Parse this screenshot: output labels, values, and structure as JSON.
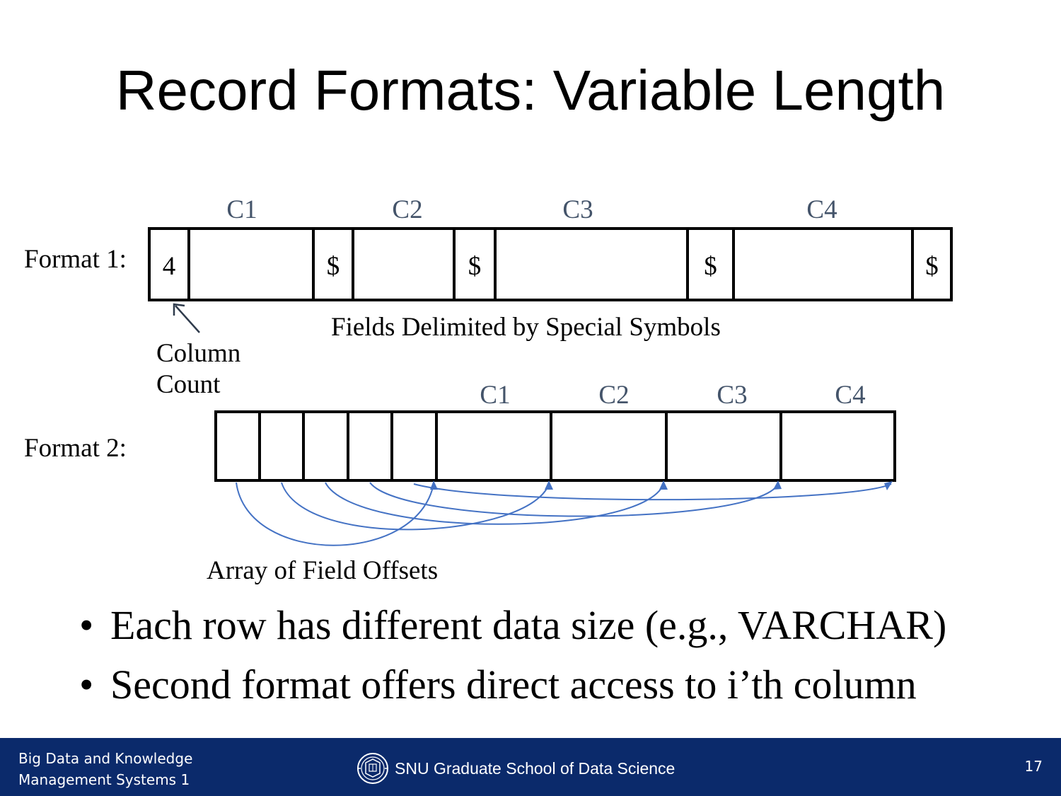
{
  "title": "Record Formats: Variable Length",
  "format1": {
    "label": "Format 1:",
    "columns": [
      "C1",
      "C2",
      "C3",
      "C4"
    ],
    "count_value": "4",
    "delimiters": [
      "$",
      "$",
      "$",
      "$"
    ],
    "caption": "Fields Delimited by Special Symbols",
    "count_caption_line1": "Column",
    "count_caption_line2": "Count"
  },
  "format2": {
    "label": "Format 2:",
    "columns": [
      "C1",
      "C2",
      "C3",
      "C4"
    ],
    "caption": "Array of Field Offsets"
  },
  "bullets": [
    "Each row has different data size (e.g., VARCHAR)",
    "Second format offers direct access to i’th column"
  ],
  "bullet_symbol": "•",
  "footer": {
    "left_line1": "Big Data and Knowledge",
    "left_line2": "Management Systems 1",
    "center": "SNU Graduate School of Data Science",
    "page": "17"
  },
  "colors": {
    "footer_bg": "#0b2a6b",
    "column_label": "#44546a",
    "arrow": "#4472c4"
  }
}
